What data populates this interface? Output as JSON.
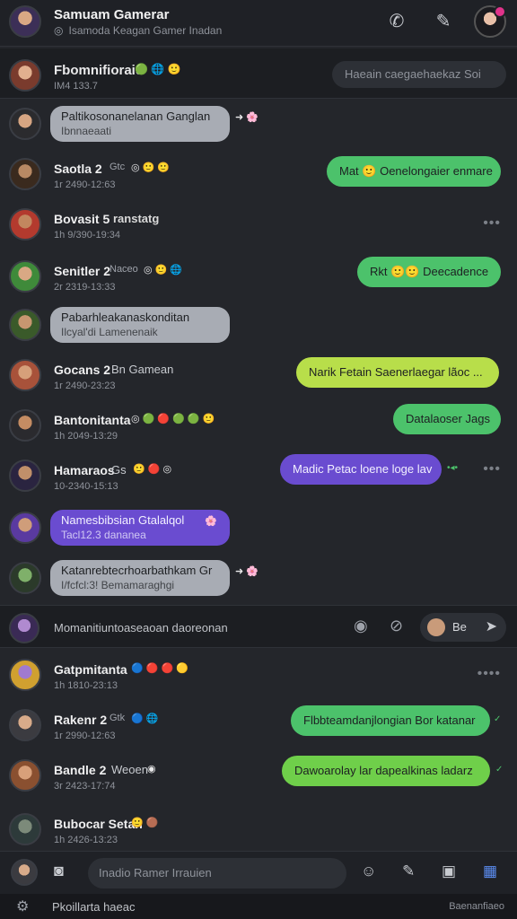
{
  "header": {
    "title": "Samuam Gamerar",
    "subtitle": "Isamoda  Keagan Gamer Inadan",
    "call_icon": "phone-icon",
    "edit_icon": "pen-icon"
  },
  "pinned": {
    "name": "Fbomnifioraie",
    "time": "IM4 133.7",
    "emoji": "🟢 🌐  🙂",
    "search_placeholder": "Haeain caegaehaekaz  Soi"
  },
  "messages": [
    {
      "name": "Paltikosonanelanan Ganglan",
      "time": "Ibnnaeaati",
      "bubble": "Paltikosonanelanan Ganglan",
      "bubble2": "Ibnnaeaati"
    },
    {
      "name": "Saotla 2",
      "extra": "Gtc",
      "time": "1r 2490-12:63",
      "bubble": "Mat 🙂 Oenelongaier enmare"
    },
    {
      "name": "Bovasit 5",
      "extra": "ranstatg",
      "time": "1h 9/390-19:34"
    },
    {
      "name": "Senitler 2",
      "extra": "Naceo",
      "time": "2r 2319-13:33",
      "bubble": "Rkt 🙂🙂 Deecadence"
    },
    {
      "name": "Pabarhleakanaskonditan",
      "time": "Ilcyal'di Lamenenaik",
      "bubble": "Pabarhleakanaskonditan",
      "bubble2": "Ilcyal'di Lamenenaik"
    },
    {
      "name": "Gocans 2",
      "extra": "Bn Gamean",
      "time": "1r 2490-23:23",
      "bubble": "Narik Fetain Saenerlaegar lãoc ..."
    },
    {
      "name": "Bantonitanta",
      "time": "1h 2049-13:29",
      "bubble": "Datalaoser Jags"
    },
    {
      "name": "Hamaraos",
      "extra": "Gs",
      "time": "10-2340-15:13",
      "bubble": "Madic Petac loene loge lav"
    },
    {
      "name": "Namesbibsian Gtalalqol",
      "time": "Tacl12.3 dananea",
      "bubble": "Namesbibsian Gtalalqol",
      "bubble2": "Tacl12.3 dananea"
    },
    {
      "name": "Katanrebtecrhoarbathkam Gr",
      "time": "I/fcfcl:3! Bemamaraghgi",
      "bubble": "Katanrebtecrhoarbathkam Gr",
      "bubble2": "I/fcfcl:3! Bemamaraghgi"
    },
    {
      "name": "Gatpmitanta",
      "time": "1h 1810-23:13"
    },
    {
      "name": "Rakenr 2",
      "extra": "Gtk",
      "time": "1r 2990-12:63",
      "bubble": "Flbbteamdanjlongian Bor katanar"
    },
    {
      "name": "Bandle 2",
      "extra": "Weoen",
      "time": "3r 2423-17:74",
      "bubble": "Dawoarolay lar dapealkinas ladarz"
    },
    {
      "name": "Bubocar Setan",
      "time": "1h 2426-13:23"
    }
  ],
  "composer_mid": {
    "text": "Momanitiuntoaseaoan daoreonan",
    "send_label": "Be"
  },
  "bottom": {
    "input_placeholder": "Inadio Ramer Irrauien"
  },
  "footer": {
    "label": "Pkoillarta haeac",
    "right_label": "Baenanfiaeo"
  }
}
